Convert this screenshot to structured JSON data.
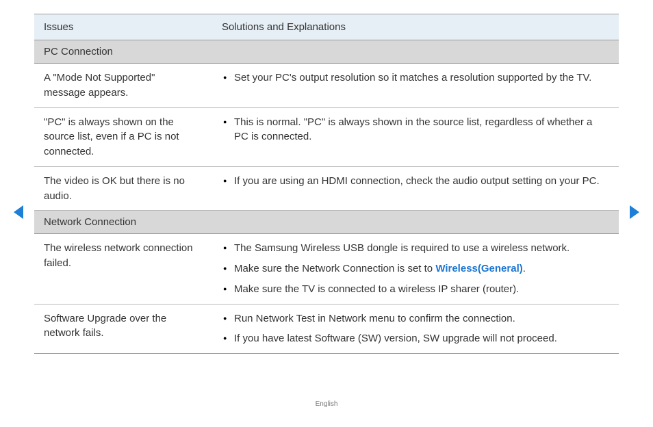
{
  "header": {
    "col1": "Issues",
    "col2": "Solutions and Explanations"
  },
  "sections": [
    {
      "title": "PC Connection",
      "rows": [
        {
          "issue": "A \"Mode Not Supported\" message appears.",
          "solutions": [
            {
              "text": "Set your PC's output resolution so it matches a resolution supported by the TV."
            }
          ]
        },
        {
          "issue": "\"PC\" is always shown on the source list, even if a PC is not connected.",
          "solutions": [
            {
              "text": "This is normal. \"PC\" is always shown in the source list, regardless of whether a PC is connected."
            }
          ]
        },
        {
          "issue": "The video is OK but there is no audio.",
          "solutions": [
            {
              "text": "If you are using an HDMI connection, check the audio output setting on your PC."
            }
          ]
        }
      ]
    },
    {
      "title": "Network Connection",
      "rows": [
        {
          "issue": "The wireless network connection failed.",
          "solutions": [
            {
              "text": "The Samsung Wireless USB dongle is required to use a wireless network."
            },
            {
              "prefix": "Make sure the Network Connection is set to ",
              "link": "Wireless(General)",
              "suffix": "."
            },
            {
              "text": "Make sure the TV is connected to a wireless IP sharer (router)."
            }
          ]
        },
        {
          "issue": "Software Upgrade over the network fails.",
          "solutions": [
            {
              "text": "Run Network Test in Network menu to confirm the connection."
            },
            {
              "text": "If you have latest Software (SW) version, SW upgrade will not proceed."
            }
          ]
        }
      ]
    }
  ],
  "footer": "English"
}
